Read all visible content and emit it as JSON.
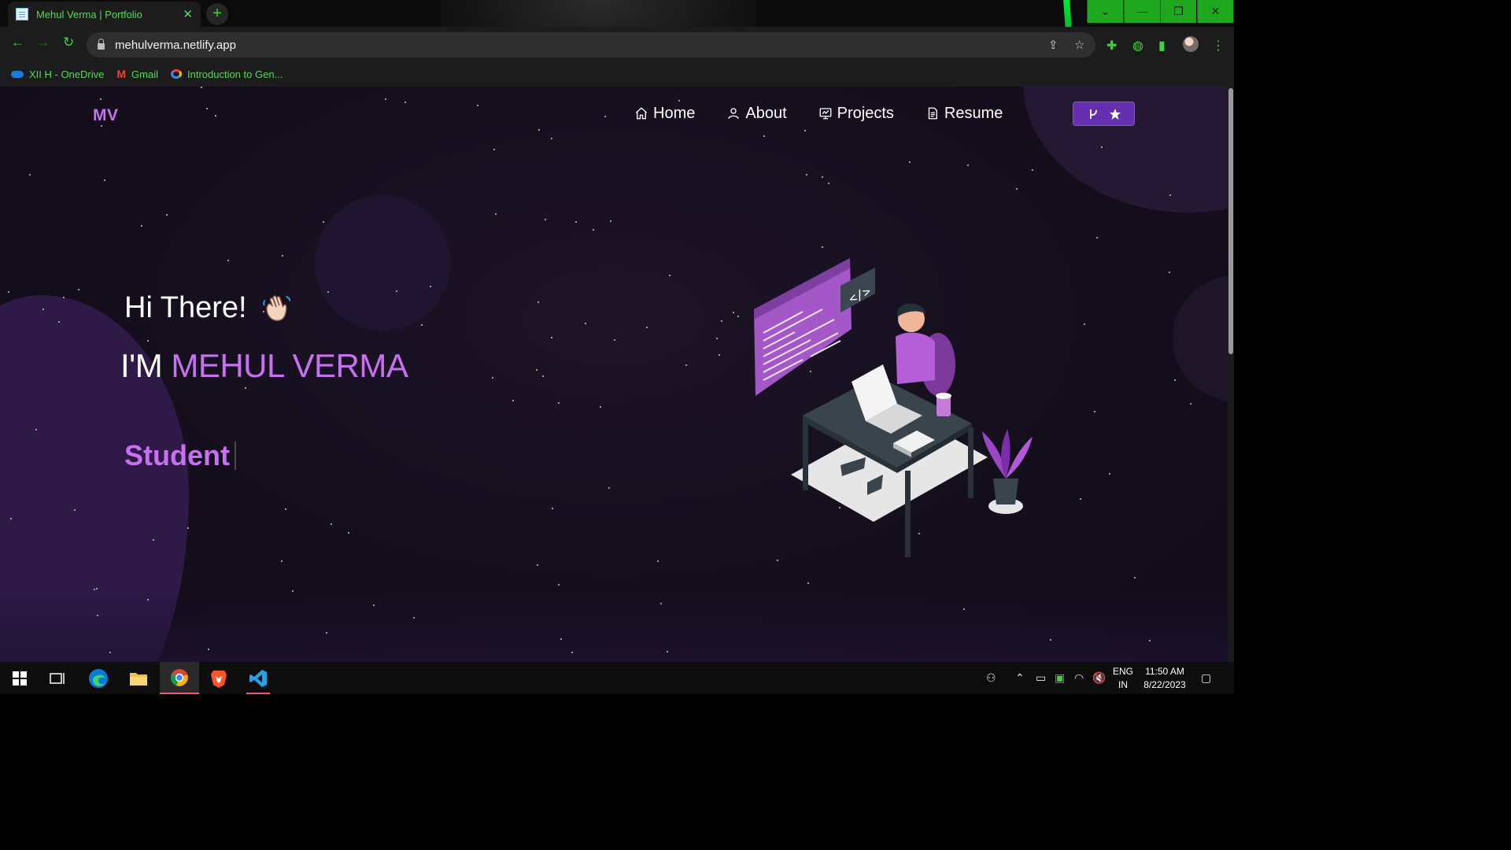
{
  "browser": {
    "tab_title": "Mehul Verma | Portfolio",
    "tab_close": "✕",
    "new_tab": "+",
    "url": "mehulverma.netlify.app",
    "bookmarks": [
      {
        "label": "XII H - OneDrive",
        "icon": "onedrive-icon"
      },
      {
        "label": "Gmail",
        "icon": "gmail-icon"
      },
      {
        "label": "Introduction to Gen...",
        "icon": "google-cloud-icon"
      }
    ],
    "window_controls": [
      "chevron-down-icon",
      "minimize-icon",
      "restore-icon",
      "close-icon"
    ],
    "accent": "#3fd43f"
  },
  "site": {
    "logo": "MV",
    "nav": [
      {
        "label": "Home",
        "icon": "home-icon"
      },
      {
        "label": "About",
        "icon": "user-icon"
      },
      {
        "label": "Projects",
        "icon": "projects-icon"
      },
      {
        "label": "Resume",
        "icon": "resume-icon"
      }
    ],
    "github_button_icons": [
      "fork-icon",
      "star-icon"
    ],
    "greeting": "Hi There!",
    "wave": "👋🏻",
    "im": "I'M ",
    "name": "MEHUL VERMA",
    "typed_text": "Student",
    "accent": "#c770f0"
  },
  "taskbar": {
    "apps": [
      "windows-start-icon",
      "task-view-icon",
      "edge-icon",
      "file-explorer-icon",
      "chrome-icon",
      "brave-icon",
      "vscode-icon"
    ],
    "lang_top": "ENG",
    "lang_bottom": "IN",
    "time": "11:50 AM",
    "date": "8/22/2023"
  }
}
